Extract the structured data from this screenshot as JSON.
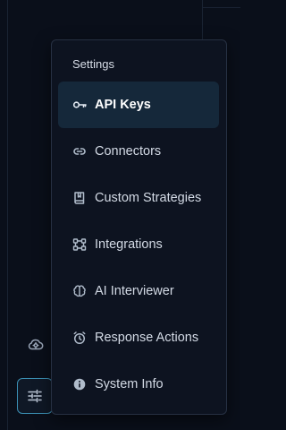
{
  "menu": {
    "heading": "Settings",
    "items": [
      {
        "label": "API Keys",
        "icon": "key-icon",
        "active": true
      },
      {
        "label": "Connectors",
        "icon": "link-icon",
        "active": false
      },
      {
        "label": "Custom Strategies",
        "icon": "book-icon",
        "active": false
      },
      {
        "label": "Integrations",
        "icon": "network-icon",
        "active": false
      },
      {
        "label": "AI Interviewer",
        "icon": "brain-icon",
        "active": false
      },
      {
        "label": "Response Actions",
        "icon": "alarm-clock-icon",
        "active": false
      },
      {
        "label": "System Info",
        "icon": "info-icon",
        "active": false
      }
    ]
  },
  "rail": {
    "top_icon": "cloud-gear-icon",
    "bottom_icon": "sliders-icon"
  },
  "colors": {
    "background": "#0a0f1a",
    "menu_background": "#0d1320",
    "active_item_background": "#15283a",
    "rail_button_border": "#3b8fb3"
  }
}
